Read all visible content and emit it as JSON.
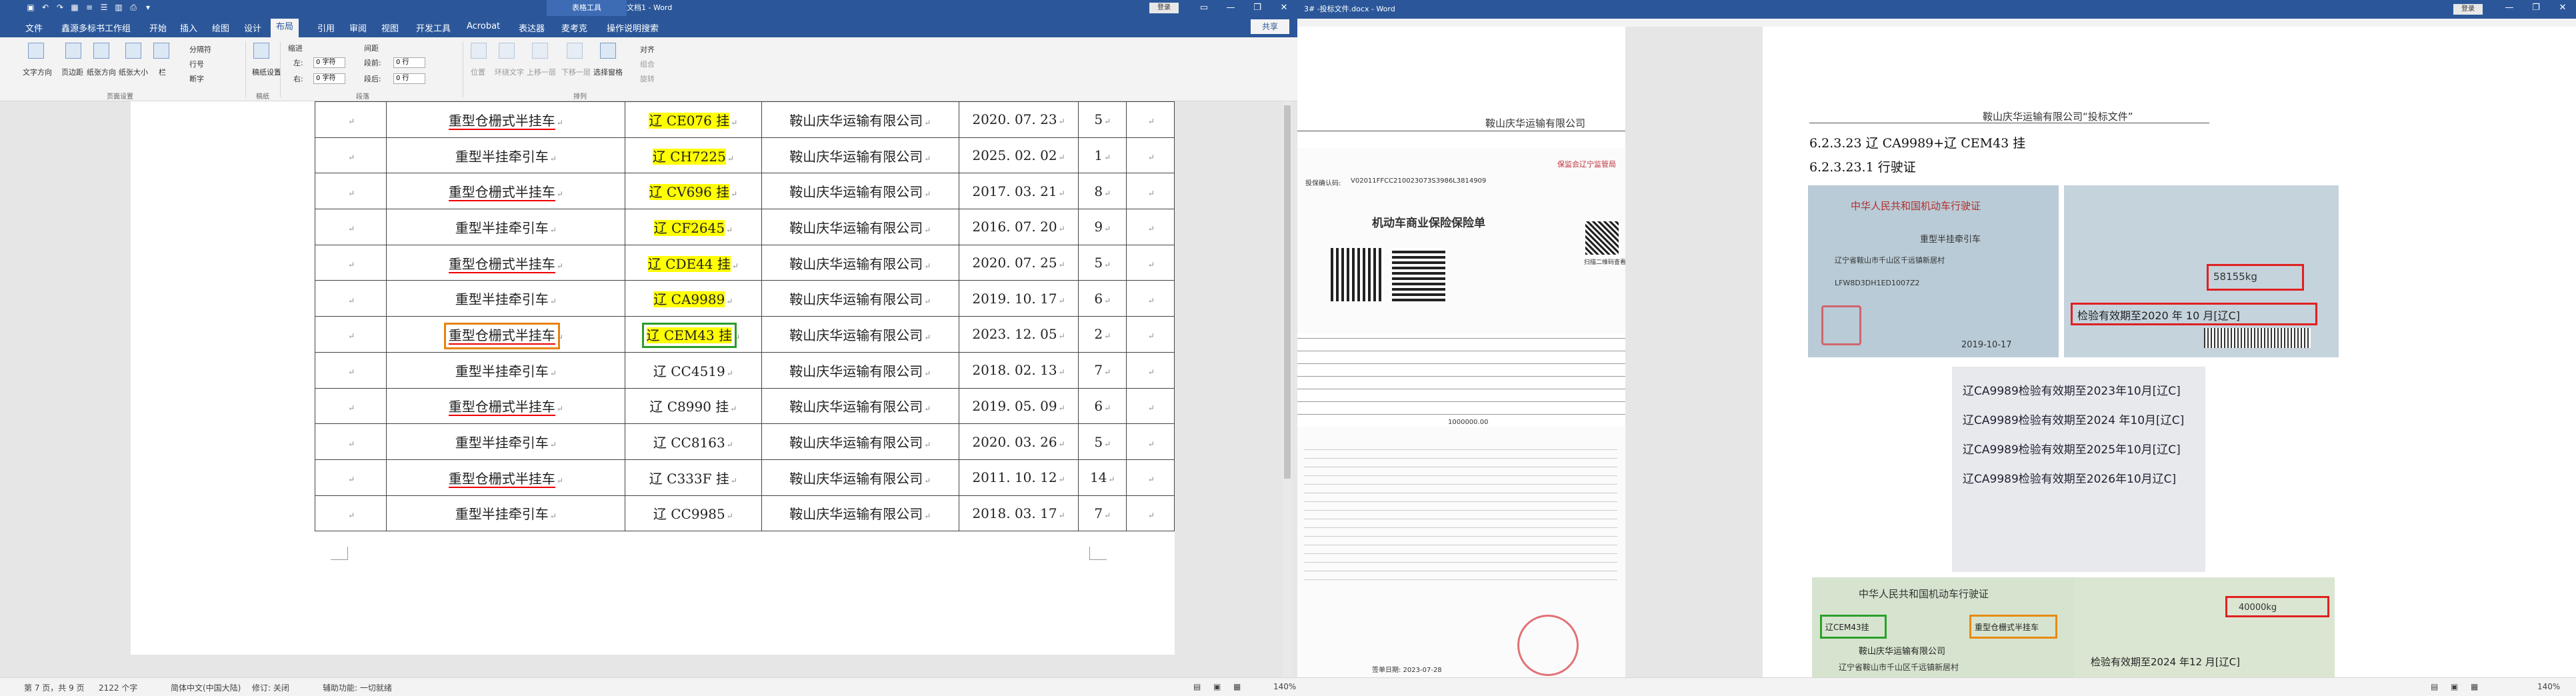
{
  "left_window": {
    "context_tab": "表格工具",
    "doc_title": "文档1 - Word",
    "login": "登录",
    "tabs": [
      "文件",
      "鑫源多标书工作组",
      "开始",
      "插入",
      "绘图",
      "设计",
      "布局",
      "引用",
      "审阅",
      "视图",
      "开发工具",
      "Acrobat",
      "表达器",
      "麦考克",
      "操作说明搜索"
    ],
    "active_tab": "布局",
    "share": "共享",
    "ribbon": {
      "text_direction": "文字方向",
      "margins": "页边距",
      "orientation": "纸张方向",
      "size": "纸张大小",
      "columns": "栏",
      "breaks": "分隔符",
      "line_numbers": "行号",
      "hyphenation": "断字",
      "page_setup_group": "页面设置",
      "draft": "稿纸设置",
      "draft_group": "稿纸",
      "indent_label": "缩进",
      "spacing_label": "间距",
      "indent_left_label": "左:",
      "indent_left": "0 字符",
      "indent_right_label": "右:",
      "indent_right": "0 字符",
      "spacing_before_label": "段前:",
      "spacing_before": "0 行",
      "spacing_after_label": "段后:",
      "spacing_after": "0 行",
      "paragraph_group": "段落",
      "position": "位置",
      "wrap_text": "环绕文字",
      "bring_forward": "上移一层",
      "send_backward": "下移一层",
      "selection_pane": "选择窗格",
      "align": "对齐",
      "group": "组合",
      "rotate": "旋转",
      "arrange_group": "排列"
    },
    "table_rows": [
      {
        "type": "重型仓栅式半挂车",
        "plate": "辽 CE076 挂",
        "company": "鞍山庆华运输有限公司",
        "date": "2020. 07. 23",
        "years": "5"
      },
      {
        "type": "重型半挂牵引车",
        "plate": "辽 CH7225",
        "company": "鞍山庆华运输有限公司",
        "date": "2025. 02. 02",
        "years": "1"
      },
      {
        "type": "重型仓栅式半挂车",
        "plate": "辽 CV696 挂",
        "company": "鞍山庆华运输有限公司",
        "date": "2017. 03. 21",
        "years": "8"
      },
      {
        "type": "重型半挂牵引车",
        "plate": "辽 CF2645",
        "company": "鞍山庆华运输有限公司",
        "date": "2016. 07. 20",
        "years": "9"
      },
      {
        "type": "重型仓栅式半挂车",
        "plate": "辽 CDE44 挂",
        "company": "鞍山庆华运输有限公司",
        "date": "2020. 07. 25",
        "years": "5"
      },
      {
        "type": "重型半挂牵引车",
        "plate": "辽 CA9989",
        "company": "鞍山庆华运输有限公司",
        "date": "2019. 10. 17",
        "years": "6"
      },
      {
        "type": "重型仓栅式半挂车",
        "plate": "辽 CEM43 挂",
        "company": "鞍山庆华运输有限公司",
        "date": "2023. 12. 05",
        "years": "2"
      },
      {
        "type": "重型半挂牵引车",
        "plate": "辽 CC4519",
        "company": "鞍山庆华运输有限公司",
        "date": "2018. 02. 13",
        "years": "7"
      },
      {
        "type": "重型仓栅式半挂车",
        "plate": "辽 C8990 挂",
        "company": "鞍山庆华运输有限公司",
        "date": "2019. 05. 09",
        "years": "6"
      },
      {
        "type": "重型半挂牵引车",
        "plate": "辽 CC8163",
        "company": "鞍山庆华运输有限公司",
        "date": "2020. 03. 26",
        "years": "5"
      },
      {
        "type": "重型仓栅式半挂车",
        "plate": "辽 C333F 挂",
        "company": "鞍山庆华运输有限公司",
        "date": "2011. 10. 12",
        "years": "14"
      },
      {
        "type": "重型半挂牵引车",
        "plate": "辽 CC9985",
        "company": "鞍山庆华运输有限公司",
        "date": "2018. 03. 17",
        "years": "7"
      }
    ],
    "status": {
      "page": "第 7 页，共 9 页",
      "words": "2122 个字",
      "lang": "简体中文(中国大陆)",
      "track": "修订: 关闭",
      "access": "辅助功能: 一切就绪",
      "zoom": "140%"
    }
  },
  "right_window": {
    "doc_title": "3# -投标文件.docx - Word",
    "login": "登录",
    "header_left": "鞍山庆华运输有限公司",
    "header_right": "鞍山庆华运输有限公司“投标文件”",
    "policy": {
      "no_label": "投保确认码:",
      "no": "V02011FFCC210023073S3986L3814909",
      "qr_text": "扫描二维码查看",
      "brand": "保监会辽宁监管局",
      "title": "机动车商业保险保险单",
      "amount": "1000000.00",
      "footer": "签单日期: 2023-07-28"
    },
    "heading1": "6.2.3.23   辽 CA9989+辽 CEM43 挂",
    "heading2": "6.2.3.23.1 行驶证",
    "license1": {
      "title": "中华人民共和国机动车行驶证",
      "type": "重型半挂牵引车",
      "weight": "58155kg",
      "address": "辽宁省鞍山市千山区千远镇新居村",
      "code": "LFW8D3DH1ED1007Z2",
      "inspect": "检验有效期至2020 年 10 月[辽C]",
      "date": "2019-10-17"
    },
    "inspections": [
      "辽CA9989检验有效期至2023年10月[辽C]",
      "辽CA9989检验有效期至2024 年10月[辽C]",
      "辽CA9989检验有效期至2025年10月[辽C]",
      "辽CA9989检验有效期至2026年10月辽C]"
    ],
    "license2": {
      "title": "中华人民共和国机动车行驶证",
      "plate": "辽CEM43挂",
      "type": "重型仓栅式半挂车",
      "owner": "鞍山庆华运输有限公司",
      "weight": "40000kg",
      "address": "辽宁省鞍山市千山区千远镇新居村",
      "inspect": "检验有效期至2024 年12 月[辽C]"
    },
    "status": {
      "zoom": "140%"
    }
  },
  "colors": {
    "word_blue": "#2b579a",
    "highlight": "#ffff00",
    "box_orange": "#e8820c",
    "box_green": "#2a9d2a",
    "box_red": "#e02020"
  }
}
